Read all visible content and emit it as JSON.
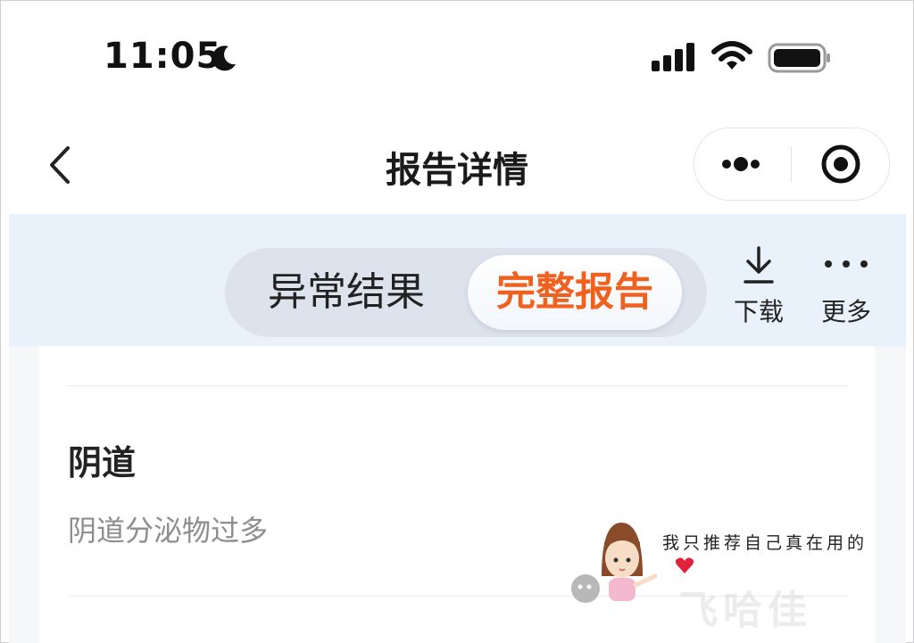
{
  "status_bar": {
    "time": "11:05",
    "icons": [
      "moon-icon",
      "signal-icon",
      "wifi-icon",
      "battery-icon"
    ]
  },
  "nav": {
    "title": "报告详情",
    "icons": [
      "back-arrow-icon",
      "more-dots-icon",
      "close-target-icon"
    ]
  },
  "tabs": {
    "items": [
      {
        "label": "异常结果",
        "selected": false
      },
      {
        "label": "完整报告",
        "selected": true
      }
    ],
    "active_color": "#f0601e"
  },
  "actions": {
    "download_label": "下载",
    "more_label": "更多"
  },
  "report": {
    "item_title": "阴道",
    "item_desc": "阴道分泌物过多"
  },
  "watermark": {
    "text": "我只推荐自己真在用的",
    "logo_text": "飞哈佳"
  }
}
